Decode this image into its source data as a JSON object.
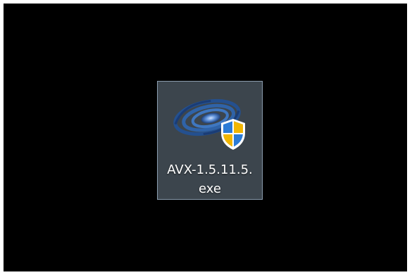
{
  "desktop": {
    "background_color": "#000000",
    "icon": {
      "label_line1": "AVX-1.5.11.5.",
      "label_line2": "exe",
      "icon_name": "galaxy-app-icon",
      "overlay_icon_name": "uac-shield-icon",
      "selected": true,
      "colors": {
        "swirl": "#2f63a8",
        "shield_blue": "#2b7bd6",
        "shield_yellow": "#f2b600"
      }
    }
  }
}
